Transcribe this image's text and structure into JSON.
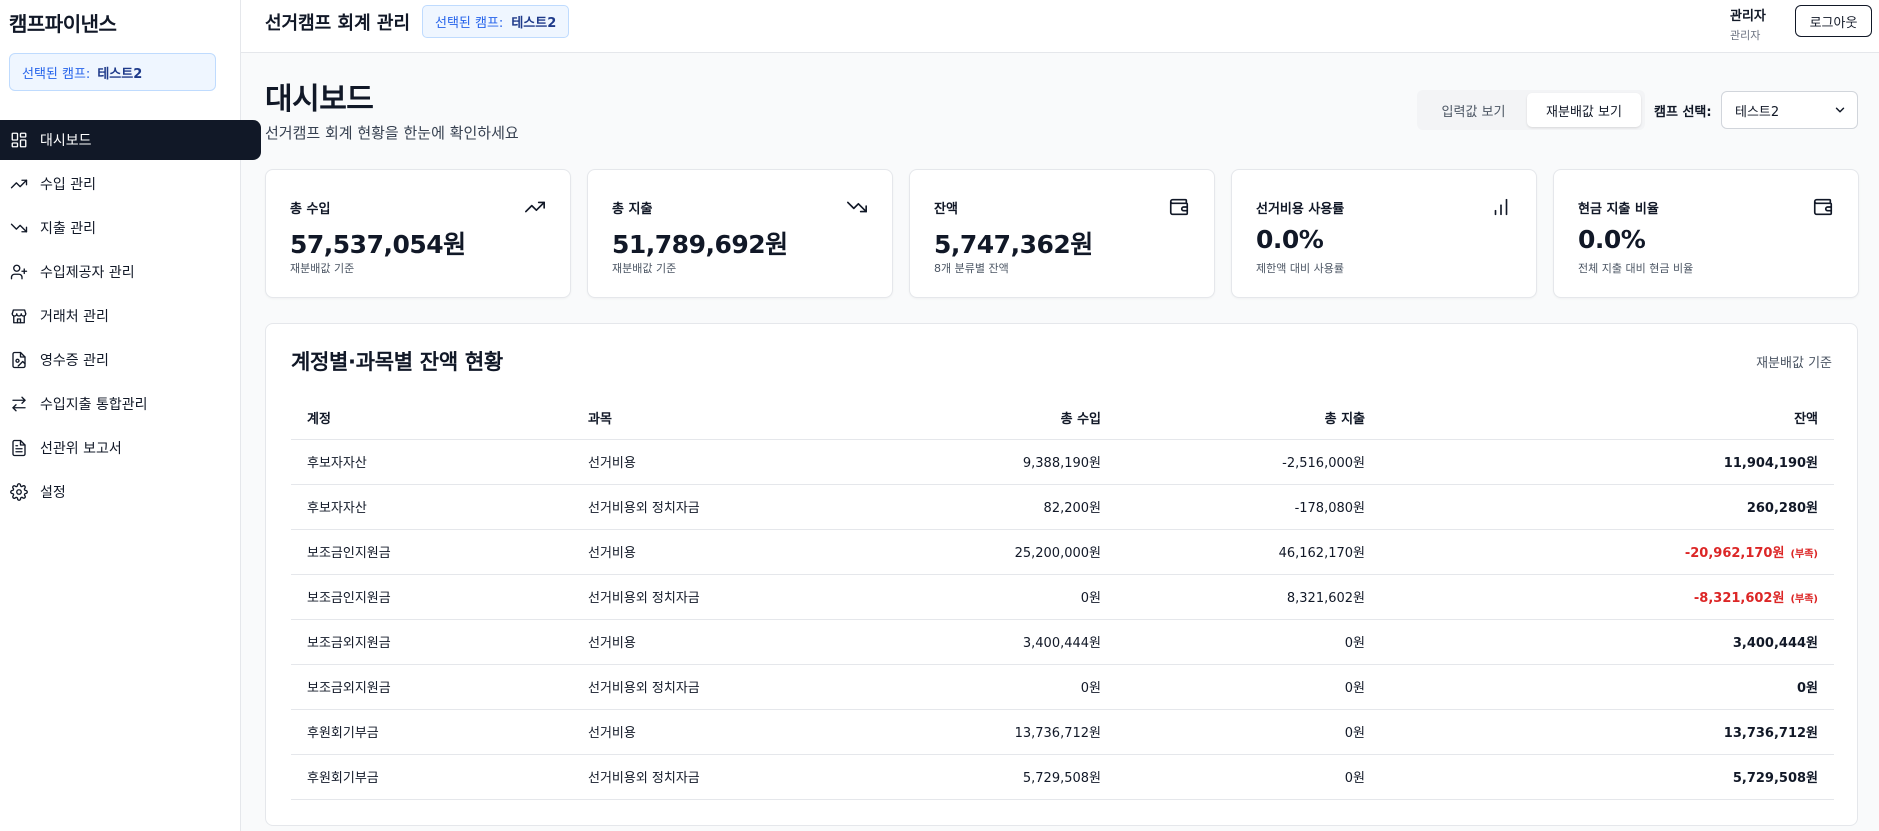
{
  "sidebar": {
    "brand": "캠프파이낸스",
    "selected_camp_label": "선택된 캠프:",
    "selected_camp_value": "테스트2",
    "items": [
      {
        "label": "대시보드",
        "icon": "dashboard-icon"
      },
      {
        "label": "수입 관리",
        "icon": "trending-up-icon"
      },
      {
        "label": "지출 관리",
        "icon": "trending-down-icon"
      },
      {
        "label": "수입제공자 관리",
        "icon": "user-plus-icon"
      },
      {
        "label": "거래처 관리",
        "icon": "store-icon"
      },
      {
        "label": "영수증 관리",
        "icon": "receipt-icon"
      },
      {
        "label": "수입지출 통합관리",
        "icon": "arrows-exchange-icon"
      },
      {
        "label": "선관위 보고서",
        "icon": "document-icon"
      },
      {
        "label": "설정",
        "icon": "gear-icon"
      }
    ]
  },
  "header": {
    "title": "선거캠프 회계 관리",
    "camp_label": "선택된 캠프:",
    "camp_value": "테스트2",
    "user_name": "관리자",
    "user_role": "관리자",
    "logout_label": "로그아웃"
  },
  "main": {
    "title": "대시보드",
    "subtitle": "선거캠프 회계 현황을 한눈에 확인하세요",
    "view_toggle": [
      "입력값 보기",
      "재분배값 보기"
    ],
    "camp_select_label": "캠프 선택:",
    "camp_select_value": "테스트2"
  },
  "stats": [
    {
      "label": "총 수입",
      "value": "57,537,054원",
      "note": "재분배값 기준",
      "icon": "trending-up-icon"
    },
    {
      "label": "총 지출",
      "value": "51,789,692원",
      "note": "재분배값 기준",
      "icon": "trending-down-icon"
    },
    {
      "label": "잔액",
      "value": "5,747,362원",
      "note": "8개 분류별 잔액",
      "icon": "wallet-icon"
    },
    {
      "label": "선거비용 사용률",
      "value": "0.0%",
      "note": "제한액 대비 사용률",
      "icon": "bar-chart-icon"
    },
    {
      "label": "현금 지출 비율",
      "value": "0.0%",
      "note": "전체 지출 대비 현금 비율",
      "icon": "wallet-icon"
    }
  ],
  "balance_table": {
    "title": "계정별·과목별 잔액 현황",
    "basis": "재분배값 기준",
    "columns": [
      "계정",
      "과목",
      "총 수입",
      "총 지출",
      "잔액"
    ],
    "rows": [
      [
        "후보자자산",
        "선거비용",
        "9,388,190원",
        "-2,516,000원",
        "11,904,190원",
        ""
      ],
      [
        "후보자자산",
        "선거비용외 정치자금",
        "82,200원",
        "-178,080원",
        "260,280원",
        ""
      ],
      [
        "보조금인지원금",
        "선거비용",
        "25,200,000원",
        "46,162,170원",
        "-20,962,170원",
        "(부족)"
      ],
      [
        "보조금인지원금",
        "선거비용외 정치자금",
        "0원",
        "8,321,602원",
        "-8,321,602원",
        "(부족)"
      ],
      [
        "보조금외지원금",
        "선거비용",
        "3,400,444원",
        "0원",
        "3,400,444원",
        ""
      ],
      [
        "보조금외지원금",
        "선거비용외 정치자금",
        "0원",
        "0원",
        "0원",
        ""
      ],
      [
        "후원회기부금",
        "선거비용",
        "13,736,712원",
        "0원",
        "13,736,712원",
        ""
      ],
      [
        "후원회기부금",
        "선거비용외 정치자금",
        "5,729,508원",
        "0원",
        "5,729,508원",
        ""
      ]
    ]
  },
  "colors": {
    "accent": "#111827",
    "negative": "#dc2626",
    "camp_badge": "#eff6ff"
  }
}
